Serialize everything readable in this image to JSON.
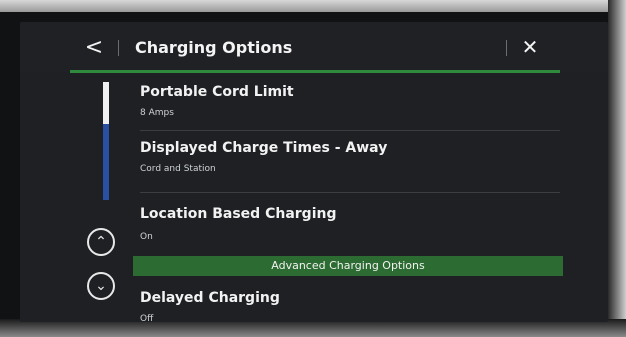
{
  "header": {
    "back_label": "<",
    "title": "Charging Options",
    "close_label": "✕"
  },
  "items": [
    {
      "title": "Portable Cord Limit",
      "value": "8 Amps"
    },
    {
      "title": "Displayed Charge Times - Away",
      "value": "Cord and Station"
    },
    {
      "title": "Location Based Charging",
      "value": "On"
    }
  ],
  "section": {
    "title": "Advanced Charging Options"
  },
  "items_advanced": [
    {
      "title": "Delayed Charging",
      "value": "Off"
    }
  ],
  "nav": {
    "up_label": "⌃",
    "down_label": "⌄"
  },
  "colors": {
    "accent_green": "#2f8a3d",
    "section_green": "#2c6b31",
    "scroll_blue": "#2a50a3"
  }
}
